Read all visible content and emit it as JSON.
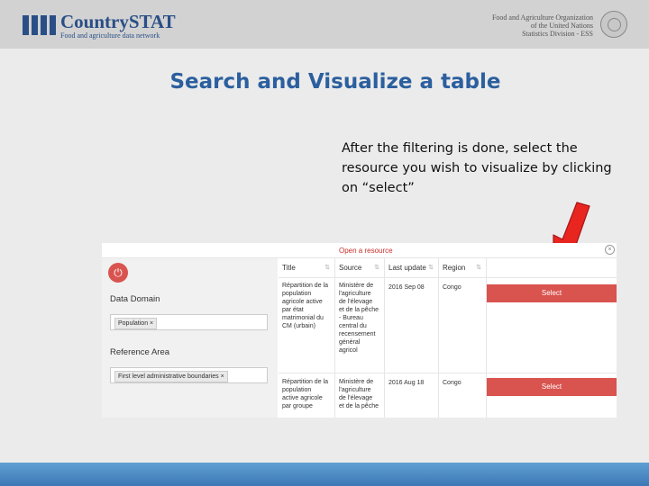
{
  "header": {
    "brand_name": "CountrySTAT",
    "brand_tagline": "Food and agriculture data network",
    "org_lines": [
      "Food and Agriculture Organization",
      "of the United Nations",
      "Statistics Division - ESS"
    ]
  },
  "slide": {
    "title": "Search and Visualize a table",
    "instruction": "After the filtering is done, select the resource you wish to visualize by clicking on “select”"
  },
  "modal": {
    "title": "Open a resource",
    "close_icon": "close-icon",
    "filters": {
      "reset_icon": "power-icon",
      "data_domain_label": "Data Domain",
      "data_domain_tag": "Population",
      "reference_area_label": "Reference Area",
      "reference_area_tag": "First level administrative boundaries",
      "remove_symbol": "×"
    },
    "table": {
      "columns": [
        "Title",
        "Source",
        "Last update",
        "Region"
      ],
      "select_label": "Select",
      "rows": [
        {
          "title": [
            "Répartition de la",
            "population",
            "agricole active",
            "par état",
            "matrimonial du",
            "CM (urbain)"
          ],
          "source": [
            "Ministère de",
            "l'agriculture",
            "de l'élevage",
            "et de la pêche",
            "- Bureau",
            "central du",
            "recensement",
            "général",
            "agricol"
          ],
          "last_update": "2016 Sep 08",
          "region": "Congo"
        },
        {
          "title": [
            "Répartition de la",
            "population",
            "active agricole",
            "par groupe"
          ],
          "source": [
            "Ministère de",
            "l'agriculture",
            "de l'élevage",
            "et de la pêche"
          ],
          "last_update": "2016 Aug 18",
          "region": "Congo"
        }
      ]
    }
  },
  "colors": {
    "brand_blue": "#2a4f86",
    "title_blue": "#2b5f9e",
    "select_red": "#d9534f",
    "arrow_red": "#e8251f"
  }
}
